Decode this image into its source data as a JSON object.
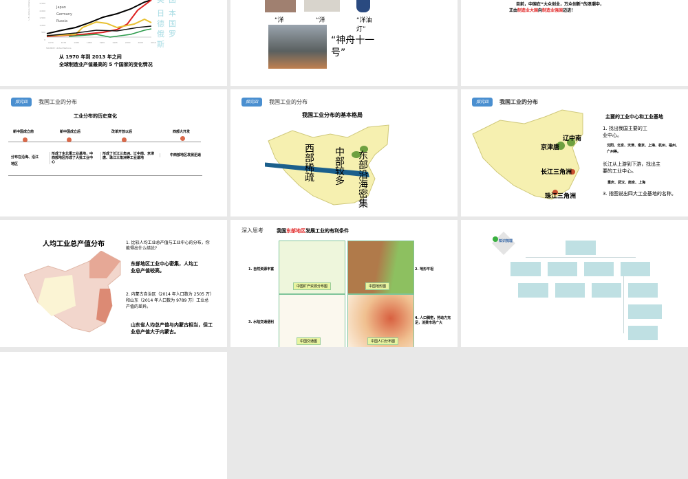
{
  "slide1": {
    "legend": [
      "Japan",
      "Germany",
      "Russia"
    ],
    "yticks": [
      "2,500",
      "2,000",
      "1,500",
      "1,000",
      "500",
      "0"
    ],
    "xticks": [
      "1970",
      "1975",
      "1980",
      "1985",
      "1990",
      "1995",
      "2000",
      "2005",
      "2010"
    ],
    "ylabel": "U.S. dollars, billions",
    "source": "SOURCE: United Nations",
    "countries": [
      "美国",
      "日本",
      "德国",
      "俄罗斯"
    ],
    "caption1": "从 1970 年到 2013 年之间",
    "caption2": "全球制造业产值最高的 5 个国家的变化情况"
  },
  "slide2": {
    "items": [
      "“洋",
      "“洋",
      "“洋油灯”"
    ],
    "rocket": "“神舟十一号”"
  },
  "slide3": {
    "line1": "目前，中国在“大众创业，万众创新”的浪潮中，",
    "pre": "正由",
    "red1": "制造业大国",
    "mid": "向",
    "red2": "制造业强国",
    "post": "迈进！"
  },
  "tag": "探究四",
  "section": "我国工业的分布",
  "slide4": {
    "title": "工业分布的历史变化",
    "periods": [
      "新中国成立前",
      "新中国成立后",
      "改革开放以后",
      "西部大开发"
    ],
    "descs": [
      "分布在沿海、沿江地区",
      "形成了东北重工业基地，中西部地区形成了大批工业中心",
      "形成了长江三角洲、辽中南、京津唐、珠江三角洲等工业基地",
      "中西部地区发展迅速"
    ]
  },
  "slide5": {
    "title": "我国工业分布的基本格局",
    "west": "西部稀疏",
    "middle": "中部较多",
    "east": "东部沿海密集"
  },
  "slide6": {
    "title": "主要的工业中心和工业基地",
    "q1": "1. 找出我国主要的工业中心。",
    "a1": "沈阳、北京、天津、南京、上海、杭州、福州、广州等。",
    "q2": "长江从上游到下游，找出主要的工业中心。",
    "a2": "重庆、武汉、南京、上海",
    "q3": "3. 指图说出四大工业基地的名称。",
    "bases": [
      "辽中南",
      "京津唐",
      "长江三角洲",
      "珠江三角洲"
    ]
  },
  "slide7": {
    "title": "人均工业总产值分布",
    "q1": "1. 比较人均工业总产值与工业中心的分布，你能得出什么结论?",
    "a1": "东部地区工业中心密集，人均工业总产值较高。",
    "q2": "2. 内蒙古自治区（2014 年人口数为 2505 万）和山东（2014 年人口数为 9789 万）工业总产值的差异。",
    "a2": "山东省人均总产值与内蒙古相当，但工业总产值大于内蒙古。"
  },
  "slide8": {
    "heading": "深入思考",
    "t_pre": "我国",
    "t_red": "东部地区",
    "t_post": "发展工业的有利条件",
    "c1": "1. 自然资源丰富",
    "c2": "2. 地形平坦",
    "c3": "3. 水陆交通便利",
    "c4": "4. 人口稠密，劳动力充足，消费市场广大",
    "maps": [
      "中国矿产资源分布图",
      "中国地形图",
      "中国交通图",
      "中国人口分布图"
    ]
  },
  "slide9": {
    "badge": "知识梳理"
  }
}
